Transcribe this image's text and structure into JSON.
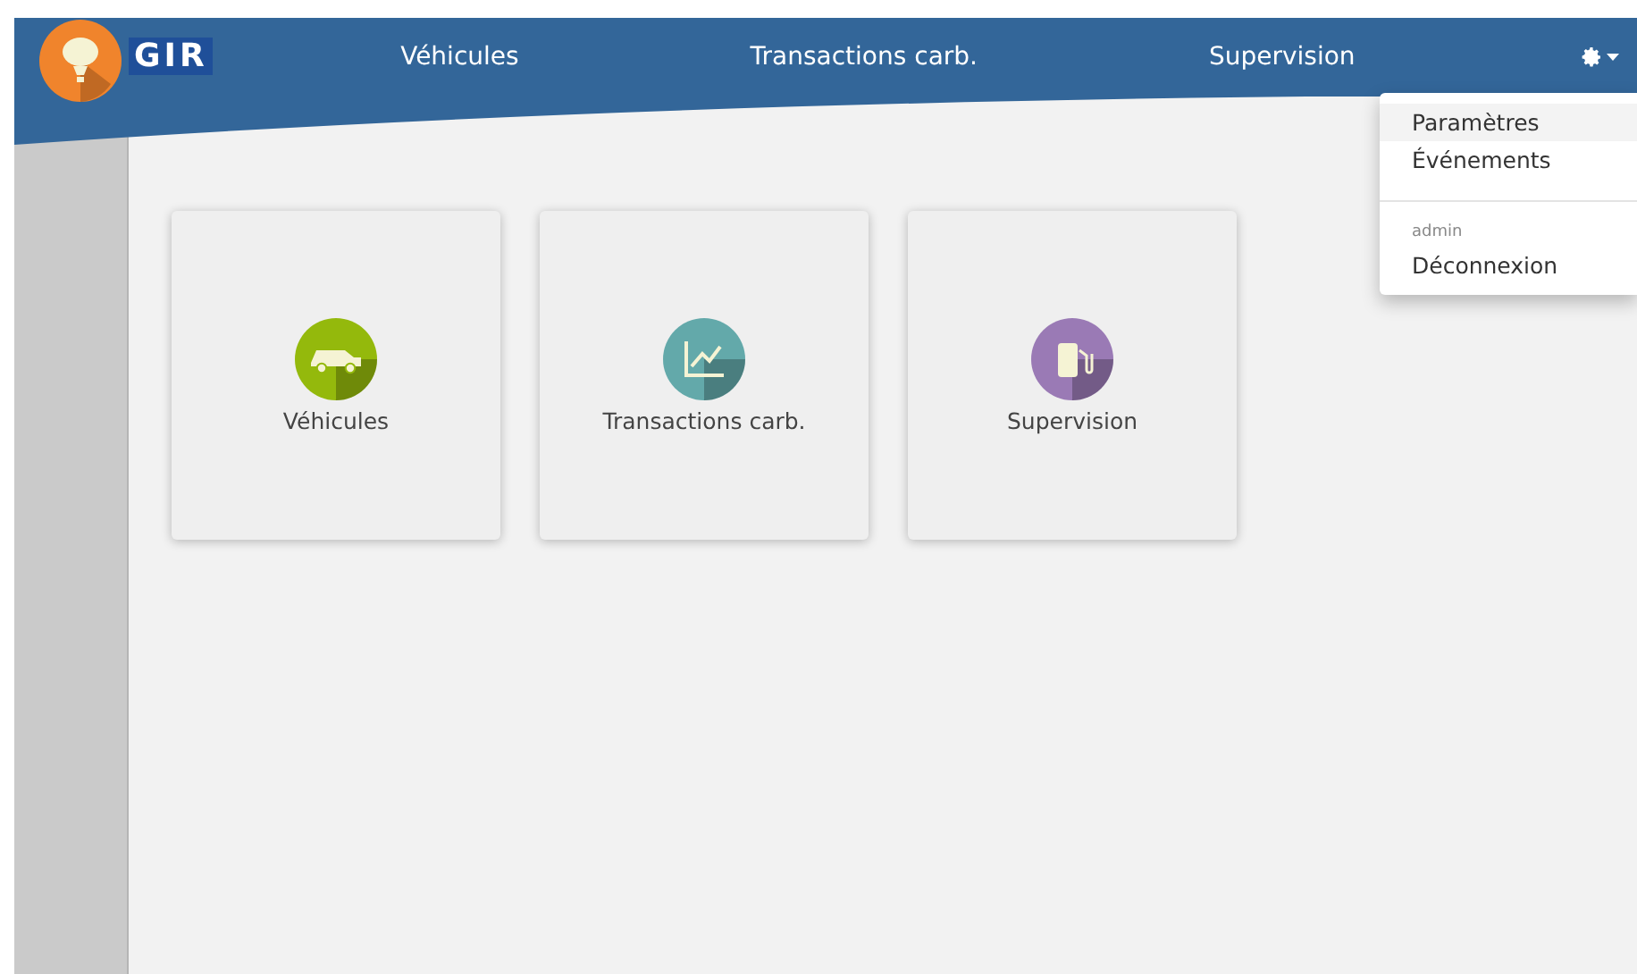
{
  "header": {
    "logo_text": "GIR",
    "nav": [
      {
        "label": "Véhicules"
      },
      {
        "label": "Transactions carb."
      },
      {
        "label": "Supervision"
      }
    ],
    "settings_menu": {
      "expanded": true
    }
  },
  "dropdown": [
    {
      "kind": "item",
      "label": "Paramètres",
      "selected": true
    },
    {
      "kind": "item",
      "label": "Événements",
      "selected": false
    },
    {
      "kind": "divider"
    },
    {
      "kind": "header",
      "label": "admin"
    },
    {
      "kind": "item",
      "label": "Déconnexion",
      "selected": false
    }
  ],
  "tiles": [
    {
      "label": "Véhicules",
      "kind": "car",
      "color": "#94b90c"
    },
    {
      "label": "Transactions carb.",
      "kind": "chart",
      "color": "#63a9aa"
    },
    {
      "label": "Supervision",
      "kind": "pump",
      "color": "#9a7ab5"
    }
  ]
}
